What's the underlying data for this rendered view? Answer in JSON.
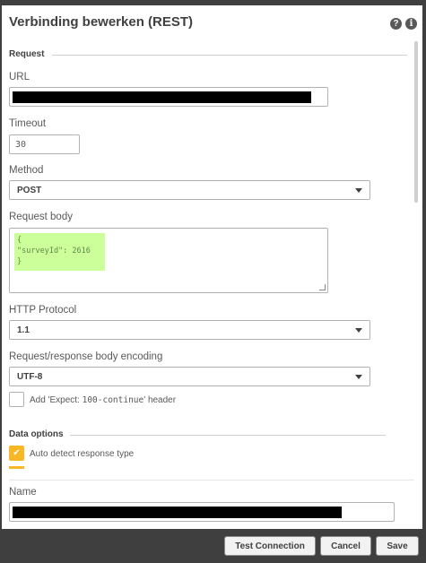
{
  "dialog": {
    "title": "Verbinding bewerken (REST)",
    "help_icon": "?",
    "info_icon": "i"
  },
  "request": {
    "section_label": "Request",
    "url_label": "URL",
    "timeout_label": "Timeout",
    "timeout_value": "30",
    "method_label": "Method",
    "method_value": "POST",
    "body_label": "Request body",
    "body_lines": [
      "{",
      "\"surveyId\": 2616",
      "}"
    ],
    "http_label": "HTTP Protocol",
    "http_value": "1.1",
    "encoding_label": "Request/response body encoding",
    "encoding_value": "UTF-8",
    "expect_label_prefix": "Add 'Expect: ",
    "expect_label_code": "100-continue",
    "expect_label_suffix": "' header"
  },
  "data_options": {
    "section_label": "Data options",
    "auto_detect_label": "Auto detect response type",
    "auto_detect_checked": true
  },
  "name_label": "Name",
  "footer": {
    "test_label": "Test Connection",
    "cancel_label": "Cancel",
    "save_label": "Save"
  },
  "colors": {
    "accent": "#f8b826",
    "code_background": "#ccff99",
    "footer_background": "#3f3f3f"
  }
}
